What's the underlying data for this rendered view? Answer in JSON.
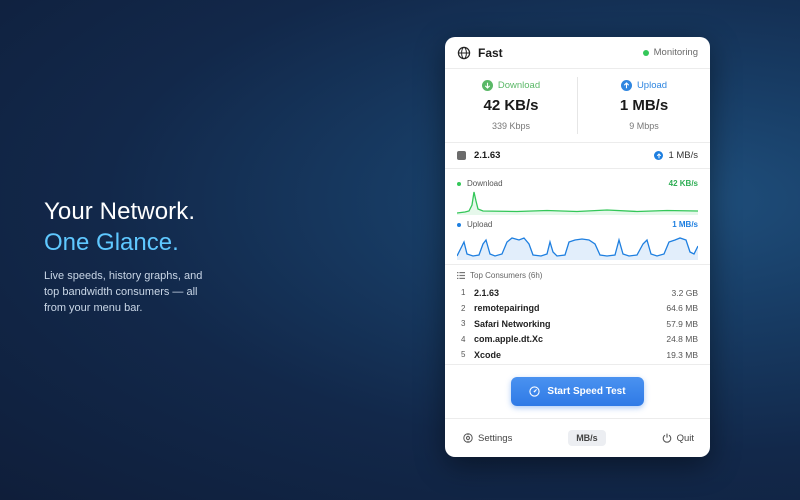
{
  "hero": {
    "headline_1": "Your Network.",
    "headline_2": "One Glance.",
    "description": "Live speeds, history graphs, and top bandwidth consumers — all from your menu bar."
  },
  "app": {
    "title": "Fast",
    "status": "Monitoring",
    "status_color": "#34c759"
  },
  "speeds": {
    "download": {
      "label": "Download",
      "value": "42 KB/s",
      "sub": "339 Kbps",
      "color": "#5ab867",
      "icon": "arrow-down-circle-icon"
    },
    "upload": {
      "label": "Upload",
      "value": "1 MB/s",
      "sub": "9 Mbps",
      "color": "#2f86e0",
      "icon": "arrow-up-circle-icon"
    }
  },
  "interface": {
    "name": "2.1.63",
    "upload": "1 MB/s"
  },
  "graphs": {
    "download": {
      "label": "Download",
      "value": "42 KB/s",
      "color": "#34c759"
    },
    "upload": {
      "label": "Upload",
      "value": "1 MB/s",
      "color": "#1e7fe0"
    }
  },
  "consumers": {
    "title": "Top Consumers (6h)",
    "items": [
      {
        "rank": "1",
        "name": "2.1.63",
        "size": "3.2 GB"
      },
      {
        "rank": "2",
        "name": "remotepairingd",
        "size": "64.6 MB"
      },
      {
        "rank": "3",
        "name": "Safari Networking",
        "size": "57.9 MB"
      },
      {
        "rank": "4",
        "name": "com.apple.dt.Xc",
        "size": "24.8 MB"
      },
      {
        "rank": "5",
        "name": "Xcode",
        "size": "19.3 MB"
      }
    ]
  },
  "actions": {
    "speed_test": "Start Speed Test",
    "settings": "Settings",
    "unit": "MB/s",
    "quit": "Quit"
  }
}
